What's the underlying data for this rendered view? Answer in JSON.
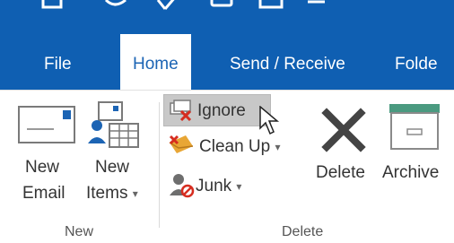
{
  "tabs": [
    {
      "label": "File"
    },
    {
      "label": "Home"
    },
    {
      "label": "Send / Receive"
    },
    {
      "label": "Folde"
    }
  ],
  "groups": {
    "new": {
      "label": "New",
      "new_email": {
        "line1": "New",
        "line2": "Email"
      },
      "new_items": {
        "line1": "New",
        "line2": "Items",
        "caret": "▾"
      }
    },
    "delete": {
      "label": "Delete",
      "ignore": "Ignore",
      "clean_up": "Clean Up",
      "clean_up_caret": "▾",
      "junk": "Junk",
      "junk_caret": "▾",
      "delete": "Delete",
      "archive": "Archive"
    }
  },
  "colors": {
    "titlebar": "#0f5fb2",
    "active_tab_text": "#1c64b4",
    "hover": "#c8c8c8"
  }
}
